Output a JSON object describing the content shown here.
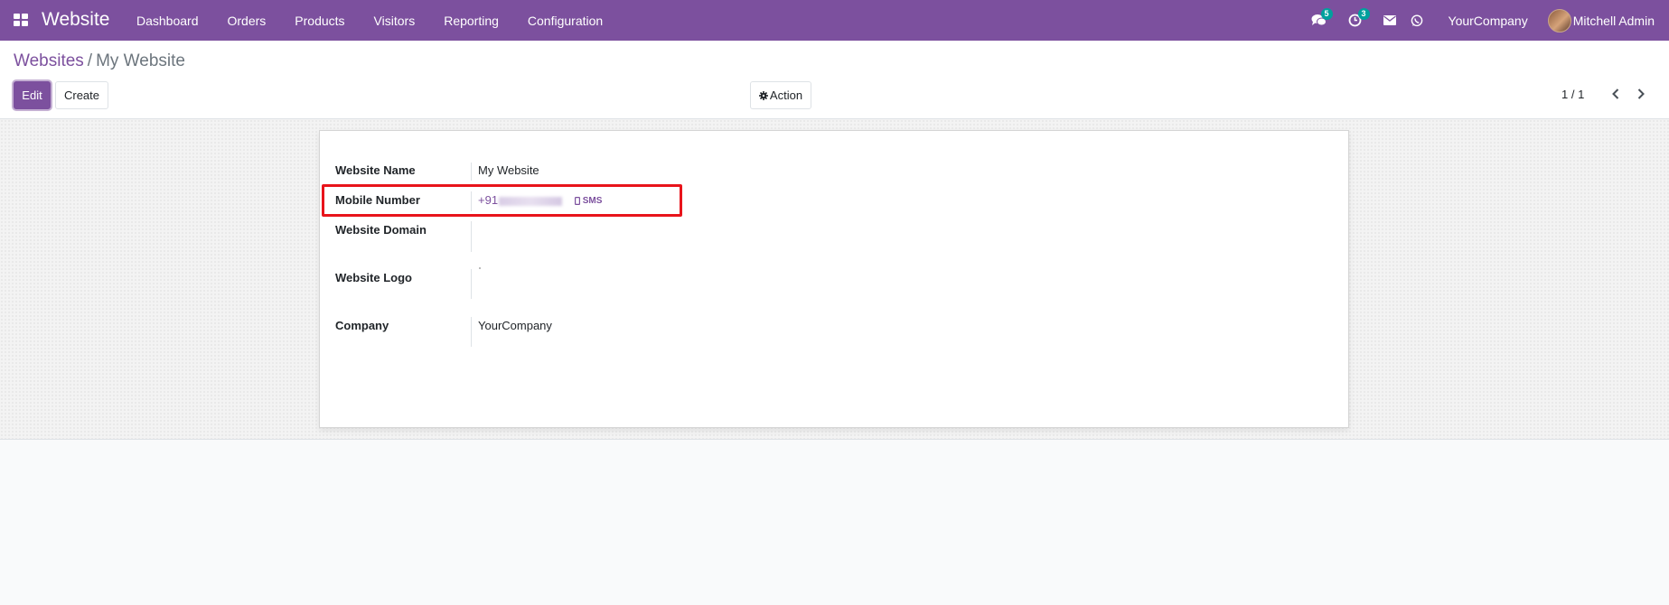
{
  "navbar": {
    "brand": "Website",
    "menu": [
      "Dashboard",
      "Orders",
      "Products",
      "Visitors",
      "Reporting",
      "Configuration"
    ],
    "messages_count": "5",
    "activities_count": "3",
    "company": "YourCompany",
    "user": "Mitchell Admin",
    "icons": [
      "apps-grid-icon",
      "chat-icon",
      "clock-icon",
      "envelope-icon",
      "whatsapp-icon"
    ]
  },
  "breadcrumb": {
    "parent": "Websites",
    "separator": "/",
    "current": "My Website"
  },
  "buttons": {
    "edit": "Edit",
    "create": "Create",
    "action": "Action"
  },
  "pager": {
    "value": "1 / 1"
  },
  "form": {
    "website_name": {
      "label": "Website Name",
      "value": "My Website"
    },
    "mobile_number": {
      "label": "Mobile Number",
      "value_prefix": "+91",
      "sms": "SMS"
    },
    "website_domain": {
      "label": "Website Domain",
      "value": ""
    },
    "website_logo": {
      "label": "Website Logo"
    },
    "company": {
      "label": "Company",
      "value": "YourCompany"
    }
  },
  "colors": {
    "brand": "#7c509e",
    "highlight": "#e8141b",
    "badge": "#00a09d"
  }
}
